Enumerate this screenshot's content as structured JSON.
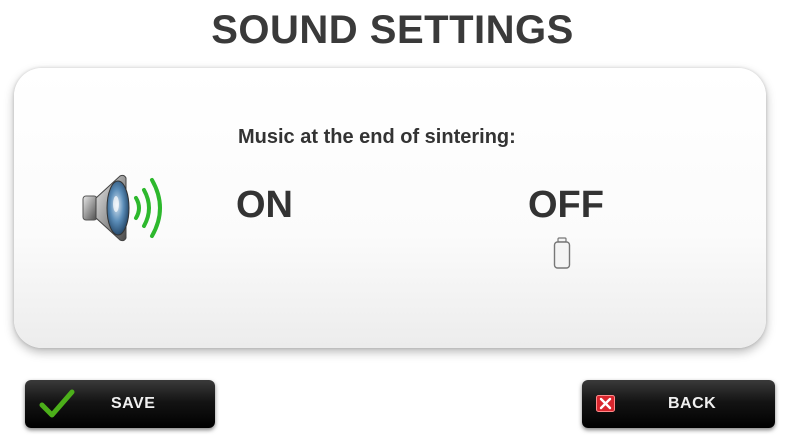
{
  "page": {
    "title": "SOUND SETTINGS"
  },
  "panel": {
    "question": "Music at the end of sintering:",
    "icon": "speaker-icon",
    "options": [
      {
        "label": "ON"
      },
      {
        "label": "OFF"
      }
    ],
    "selected": "OFF",
    "colors": {
      "speaker_waves": "#2db82d",
      "text": "#333333"
    }
  },
  "buttons": {
    "save": {
      "label": "SAVE",
      "icon": "check-icon",
      "icon_color": "#4caf1a"
    },
    "back": {
      "label": "BACK",
      "icon": "x-icon",
      "icon_color": "#d9262e"
    }
  }
}
